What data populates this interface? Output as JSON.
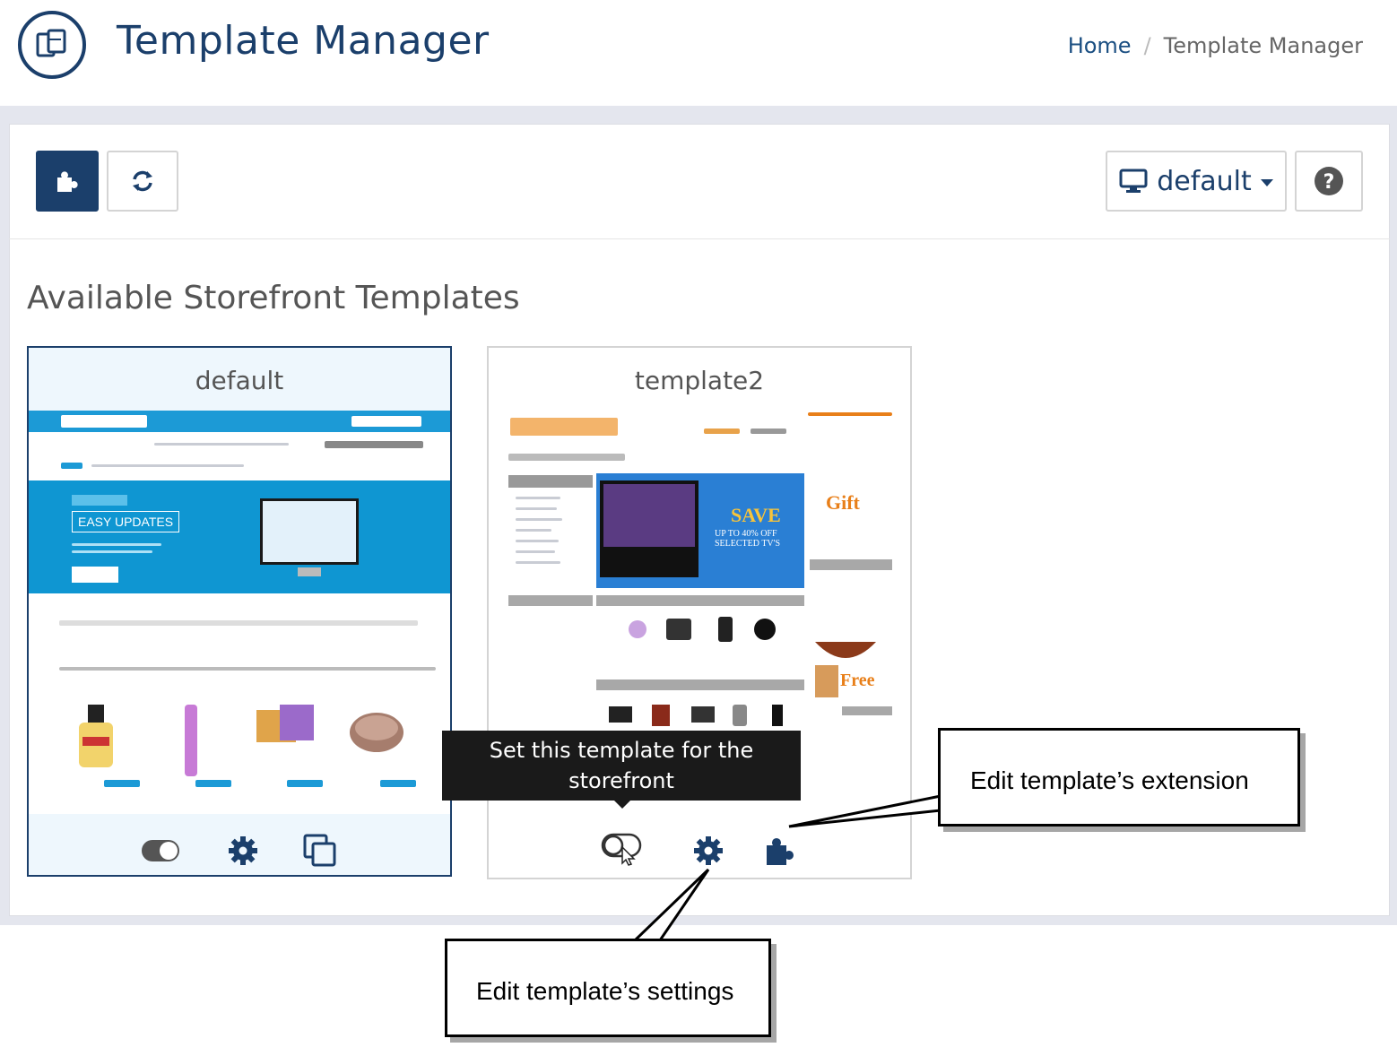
{
  "header": {
    "title": "Template Manager",
    "breadcrumb": {
      "home": "Home",
      "separator": "/",
      "current": "Template Manager"
    }
  },
  "toolbar": {
    "selector_label": "default",
    "buttons": [
      "puzzle-icon",
      "refresh-icon",
      "desktop-icon",
      "question-circle-icon"
    ]
  },
  "section": {
    "title": "Available Storefront Templates"
  },
  "templates": [
    {
      "name": "default",
      "active": true,
      "preview_headline": "EASY UPDATES",
      "actions": [
        "toggle-on-icon",
        "gear-icon",
        "copy-icon"
      ]
    },
    {
      "name": "template2",
      "active": false,
      "preview_headline": "SAVE",
      "preview_subline_1": "UP TO 40% OFF",
      "preview_subline_2": "SELECTED TV'S",
      "preview_gift": "Gift",
      "preview_free": "Free",
      "actions": [
        "toggle-off-icon",
        "gear-icon",
        "puzzle-icon"
      ]
    }
  ],
  "tooltip": {
    "line1": "Set this template for the",
    "line2": "storefront"
  },
  "callouts": {
    "extension": "Edit template’s extension",
    "settings": "Edit template’s settings"
  },
  "colors": {
    "brand": "#1b3f6b",
    "panel_band": "#e4e6ee",
    "active_card_bg": "#eef7fd",
    "hero_blue": "#0f96d2"
  }
}
